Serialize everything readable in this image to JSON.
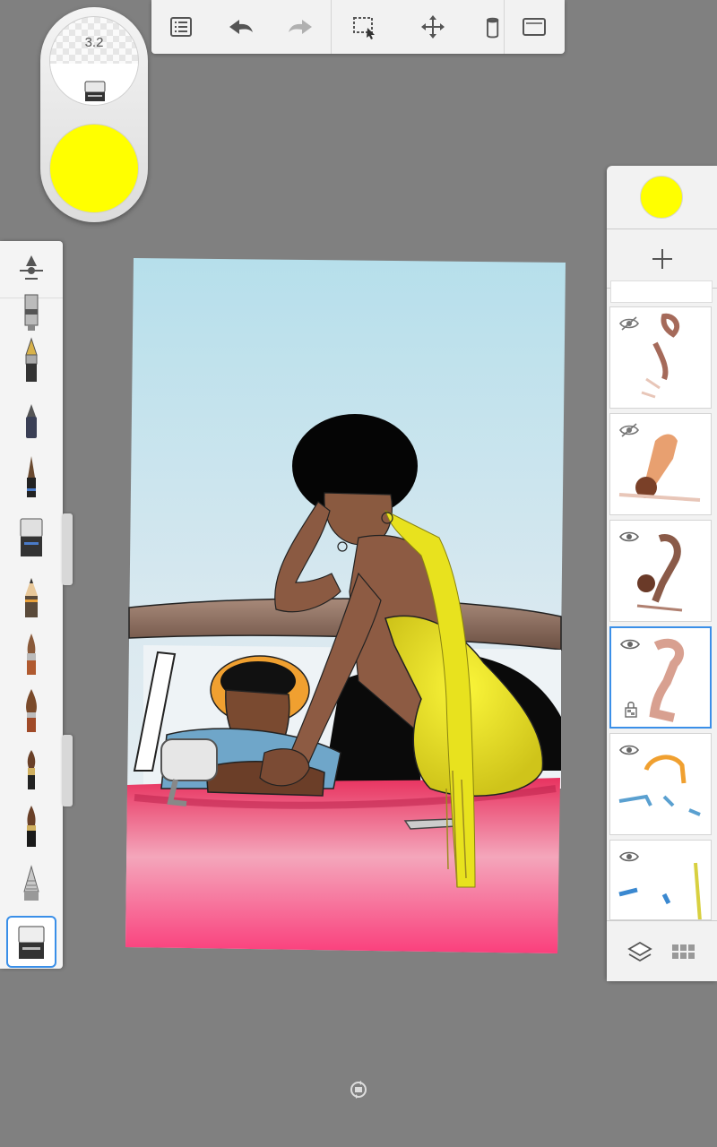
{
  "brush_puck": {
    "size_value": "3.2",
    "current_color": "#FFFF00"
  },
  "toolbar": {
    "items": [
      "list-icon",
      "undo-icon",
      "redo-icon",
      "selection-icon",
      "move-icon",
      "fill-icon",
      "fullscreen-icon"
    ]
  },
  "brush_palette": {
    "items": [
      "airbrush",
      "fountain-pen",
      "ballpoint-pen",
      "fineliner",
      "marker",
      "pencil",
      "paintbrush",
      "flat-brush",
      "round-brush",
      "ink-brush",
      "hard-pencil",
      "eraser"
    ],
    "active_index": 11
  },
  "layer_panel": {
    "current_color": "#FFFF00",
    "layers": [
      {
        "visible": false,
        "active": false,
        "locked": false
      },
      {
        "visible": false,
        "active": false,
        "locked": false
      },
      {
        "visible": true,
        "active": false,
        "locked": false
      },
      {
        "visible": true,
        "active": true,
        "locked": true
      },
      {
        "visible": true,
        "active": false,
        "locked": false
      },
      {
        "visible": true,
        "active": false,
        "locked": false
      }
    ]
  },
  "colors": {
    "accent": "#3A8FE8",
    "sky_top": "#B8E0EC",
    "car_pink": "#F2457A",
    "dress_yellow": "#F2EC2A"
  }
}
